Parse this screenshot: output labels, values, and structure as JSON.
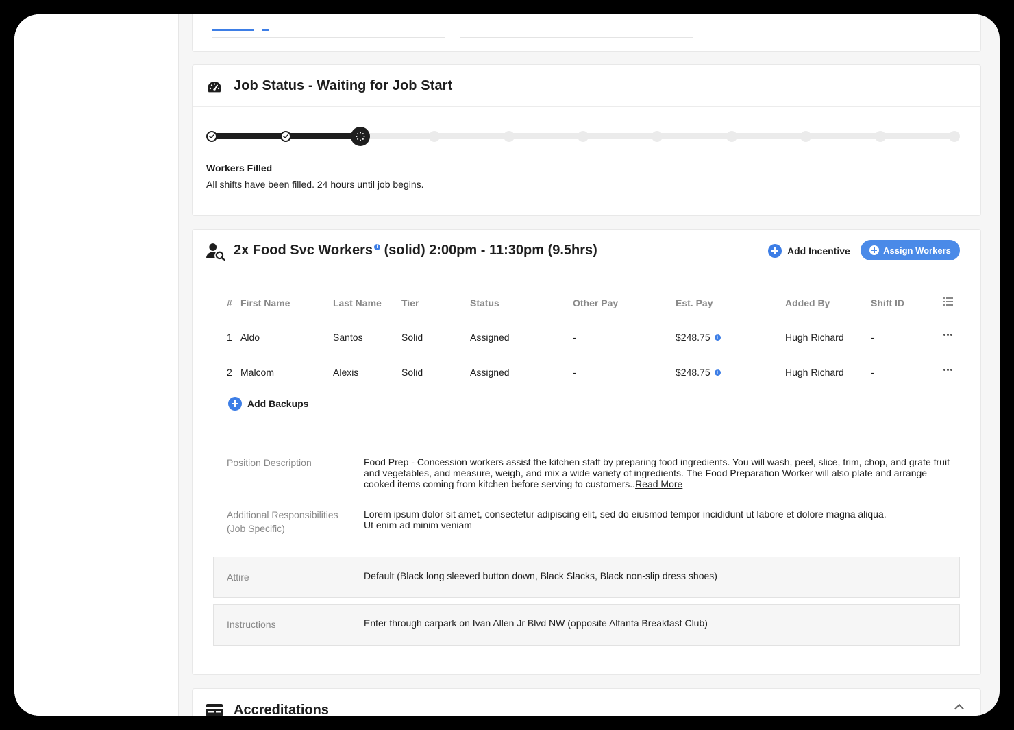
{
  "status_card": {
    "title": "Job Status - Waiting for Job Start",
    "icon": "speedometer-icon",
    "progress": {
      "total_steps": 11,
      "completed_steps": 2,
      "current_step": 3
    },
    "label": "Workers Filled",
    "text": "All shifts have been filled. 24 hours until job begins."
  },
  "shift_card": {
    "icon": "user-search-icon",
    "title_main": "2x Food Svc Workers",
    "title_rest": "(solid) 2:00pm - 11:30pm (9.5hrs)",
    "add_incentive_label": "Add Incentive",
    "assign_workers_label": "Assign Workers",
    "accent_color": "#4a8ae8",
    "table": {
      "headers": [
        "#",
        "First Name",
        "Last Name",
        "Tier",
        "Status",
        "Other Pay",
        "Est. Pay",
        "Added By",
        "Shift ID"
      ],
      "rows": [
        {
          "num": "1",
          "first": "Aldo",
          "last": "Santos",
          "tier": "Solid",
          "status": "Assigned",
          "other_pay": "-",
          "est_pay": "$248.75",
          "added_by": "Hugh Richard",
          "shift_id": "-"
        },
        {
          "num": "2",
          "first": "Malcom",
          "last": "Alexis",
          "tier": "Solid",
          "status": "Assigned",
          "other_pay": "-",
          "est_pay": "$248.75",
          "added_by": "Hugh Richard",
          "shift_id": "-"
        }
      ]
    },
    "add_backups_label": "Add Backups",
    "details": {
      "position_label": "Position Description",
      "position_text": "Food Prep - Concession workers assist the kitchen staff by preparing food ingredients. You will wash, peel, slice, trim, chop, and grate fruit and vegetables, and measure, weigh, and mix a wide variety of ingredients. The Food Preparation Worker will also plate and arrange cooked items coming from kitchen before serving to customers..",
      "read_more": "Read More",
      "additional_label_1": "Additional Responsibilities",
      "additional_label_2": "(Job Specific)",
      "additional_text": "Lorem ipsum dolor sit amet, consectetur adipiscing elit, sed do eiusmod tempor incididunt ut labore et dolore magna aliqua. Ut enim ad minim veniam",
      "attire_label": "Attire",
      "attire_text": "Default (Black long sleeved button down, Black Slacks, Black non-slip dress shoes)",
      "instructions_label": "Instructions",
      "instructions_text": "Enter through carpark on Ivan Allen Jr Blvd NW (opposite Altanta Breakfast Club)"
    }
  },
  "accreditations_card": {
    "title": "Accreditations",
    "icon": "id-card-icon"
  }
}
